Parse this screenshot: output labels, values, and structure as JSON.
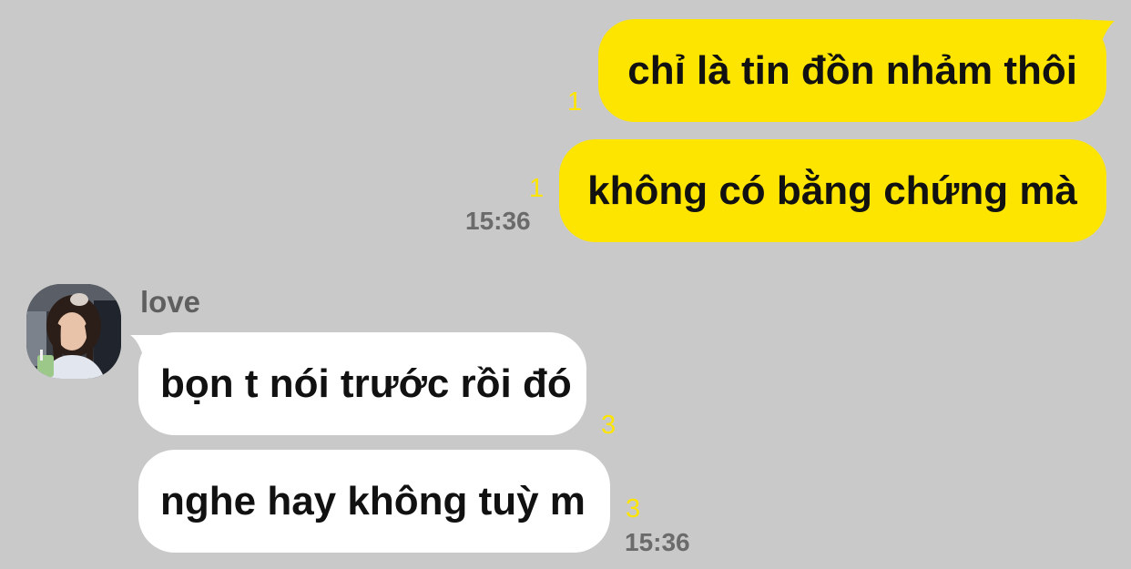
{
  "colors": {
    "background": "#c9c9c9",
    "outgoing_bubble": "#fee500",
    "incoming_bubble": "#ffffff",
    "unread_count": "#fee500",
    "timestamp": "#6b6b6b",
    "sender_name": "#5f5f5f"
  },
  "outgoing": {
    "messages": [
      {
        "text": "chỉ là tin đồn nhảm thôi",
        "unread": "1"
      },
      {
        "text": "không có bằng chứng mà",
        "unread": "1"
      }
    ],
    "time": "15:36"
  },
  "incoming": {
    "sender": "love",
    "avatar_icon": "profile-photo",
    "messages": [
      {
        "text": "bọn t nói trước rồi đó",
        "unread": "3"
      },
      {
        "text": "nghe hay không tuỳ m",
        "unread": "3"
      }
    ],
    "time": "15:36"
  }
}
